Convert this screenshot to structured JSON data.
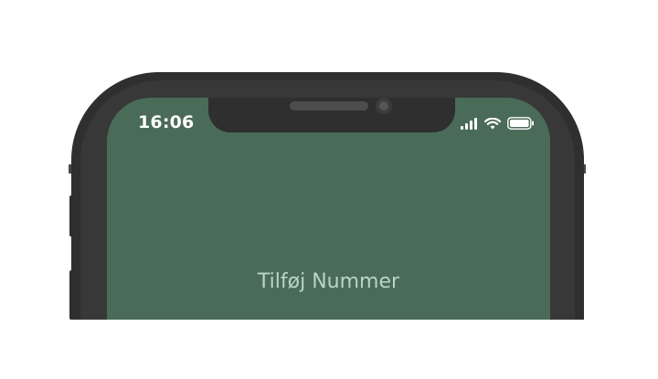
{
  "status_bar": {
    "time": "16:06",
    "icons": [
      "signal-icon",
      "wifi-icon",
      "battery-icon"
    ]
  },
  "screen": {
    "title": "Tilføj Nummer",
    "background_color": "#4a6b58"
  }
}
